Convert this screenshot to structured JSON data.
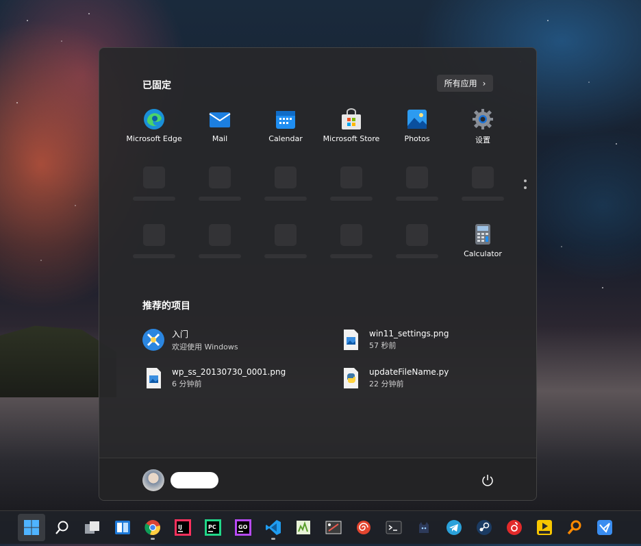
{
  "start_menu": {
    "pinned_title": "已固定",
    "all_apps_label": "所有应用",
    "pinned_apps": [
      {
        "label": "Microsoft Edge",
        "icon": "edge-icon"
      },
      {
        "label": "Mail",
        "icon": "mail-icon"
      },
      {
        "label": "Calendar",
        "icon": "calendar-icon"
      },
      {
        "label": "Microsoft Store",
        "icon": "store-icon"
      },
      {
        "label": "Photos",
        "icon": "photos-icon"
      },
      {
        "label": "设置",
        "icon": "settings-gear-icon"
      },
      {
        "label": "Calculator",
        "icon": "calculator-icon"
      }
    ],
    "recommended_title": "推荐的项目",
    "recommended": [
      {
        "name": "入门",
        "time": "欢迎使用 Windows",
        "icon": "get-started-icon"
      },
      {
        "name": "win11_settings.png",
        "time": "57 秒前",
        "icon": "image-file-icon"
      },
      {
        "name": "wp_ss_20130730_0001.png",
        "time": "6 分钟前",
        "icon": "image-file-icon"
      },
      {
        "name": "updateFileName.py",
        "time": "22 分钟前",
        "icon": "python-file-icon"
      }
    ]
  },
  "colors": {
    "accent": "#0078d4",
    "menu_bg": "#28282a",
    "taskbar_bg": "#1e2228"
  },
  "taskbar_icons": [
    "start-icon",
    "search-icon",
    "task-view-icon",
    "widgets-icon",
    "chrome-icon",
    "intellij-icon",
    "pycharm-icon",
    "goland-icon",
    "vscode-icon",
    "notepad-icon",
    "snipping-icon",
    "app-spiral-icon",
    "terminal-icon",
    "cat-app-icon",
    "telegram-icon",
    "steam-icon",
    "netease-music-icon",
    "potplayer-icon",
    "search-everything-icon",
    "feishu-icon"
  ]
}
